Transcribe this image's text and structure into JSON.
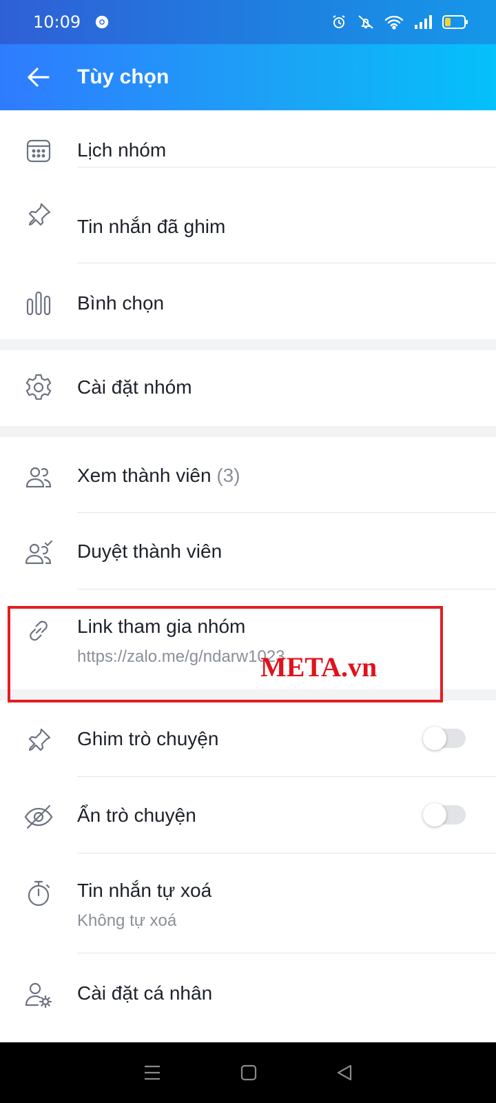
{
  "status_bar": {
    "time": "10:09",
    "icons": [
      "chrome-icon",
      "alarm-icon",
      "vibrate-off-icon",
      "wifi-icon",
      "signal-icon",
      "battery-icon"
    ]
  },
  "app_bar": {
    "title": "Tùy chọn",
    "back_icon": "arrow-left-icon"
  },
  "menu": {
    "group_calendar": {
      "label": "Lịch nhóm",
      "icon": "calendar-icon"
    },
    "pinned_messages": {
      "label": "Tin nhắn đã ghim",
      "icon": "pin-icon"
    },
    "polls": {
      "label": "Bình chọn",
      "icon": "bar-chart-icon"
    },
    "group_settings": {
      "label": "Cài đặt nhóm",
      "icon": "gear-icon"
    },
    "view_members": {
      "label": "Xem thành viên",
      "count": "(3)",
      "icon": "people-icon"
    },
    "approve_members": {
      "label": "Duyệt thành viên",
      "icon": "people-check-icon"
    },
    "join_link": {
      "label": "Link tham gia nhóm",
      "sub": "https://zalo.me/g/ndarw1023",
      "icon": "link-icon"
    },
    "pin_chat": {
      "label": "Ghim trò chuyện",
      "icon": "pin-icon",
      "toggle_on": false
    },
    "hide_chat": {
      "label": "Ẩn trò chuyện",
      "icon": "eye-off-icon",
      "toggle_on": false
    },
    "auto_delete": {
      "label": "Tin nhắn tự xoá",
      "sub": "Không tự xoá",
      "icon": "timer-icon"
    },
    "personal_settings": {
      "label": "Cài đặt cá nhân",
      "icon": "user-gear-icon"
    }
  },
  "watermark": "META.vn",
  "colors": {
    "accent": "#1aa5f5",
    "highlight_border": "#e31d24",
    "watermark": "#e0121b",
    "text": "#1d2129",
    "subtext": "#8a8f98",
    "icon": "#6b7280"
  },
  "nav_bar": {
    "icons": [
      "menu-icon",
      "home-icon",
      "back-triangle-icon"
    ]
  }
}
